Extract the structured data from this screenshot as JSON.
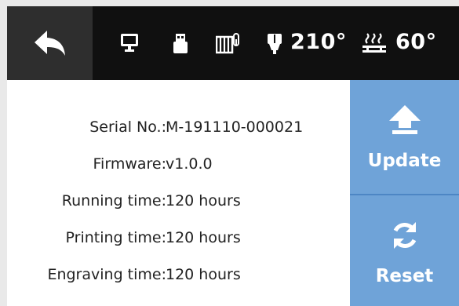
{
  "topbar": {
    "icons": [
      "back-arrow-icon",
      "display-icon",
      "usb-icon",
      "heatbed-icon",
      "nozzle-icon",
      "heat-icon"
    ],
    "nozzle_temp": "210°",
    "bed_temp": "60°"
  },
  "info": {
    "rows": [
      {
        "label": "Serial No.:",
        "value": "M-191110-000021"
      },
      {
        "label": "Firmware:",
        "value": "v1.0.0"
      },
      {
        "label": "Running time:",
        "value": "120 hours"
      },
      {
        "label": "Printing time:",
        "value": "120 hours"
      },
      {
        "label": "Engraving time:",
        "value": "120 hours"
      }
    ]
  },
  "actions": {
    "update_label": "Update",
    "reset_label": "Reset"
  },
  "colors": {
    "topbar_bg": "#101010",
    "back_bg": "#2e2e2e",
    "accent": "#6fa3d8",
    "divider": "#4d86c4"
  }
}
